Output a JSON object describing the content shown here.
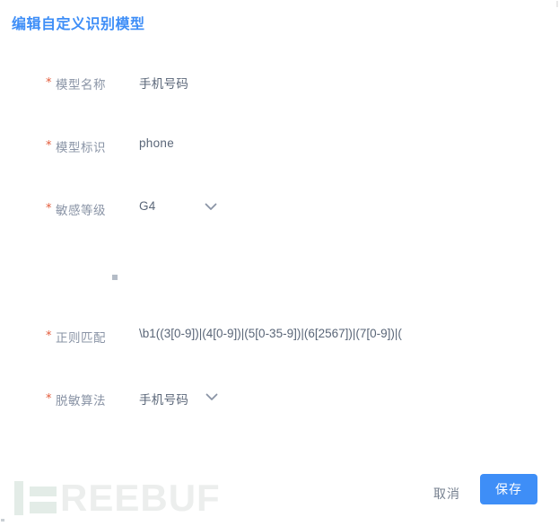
{
  "dialog": {
    "title": "编辑自定义识别模型",
    "title_color": "#3e8ef7"
  },
  "form": {
    "required_marker": "*",
    "fields": [
      {
        "label": "模型名称",
        "value": "手机号码",
        "type": "text",
        "required": true
      },
      {
        "label": "模型标识",
        "value": "phone",
        "type": "text",
        "required": true
      },
      {
        "label": "敏感等级",
        "value": "G4",
        "type": "select",
        "required": true,
        "icon": "chevron-down-icon"
      },
      {
        "label": "正则匹配",
        "value": "\\b1((3[0-9])|(4[0-9])|(5[0-35-9])|(6[2567])|(7[0-9])|(",
        "type": "text",
        "required": true
      },
      {
        "label": "脱敏算法",
        "value": "手机号码",
        "type": "select",
        "required": true,
        "icon": "chevron-down-icon"
      }
    ]
  },
  "footer": {
    "cancel_label": "取消",
    "save_label": "保存",
    "save_color": "#3e8ef7"
  },
  "watermark": {
    "text": "REEBUF",
    "color": "#eceeed"
  }
}
